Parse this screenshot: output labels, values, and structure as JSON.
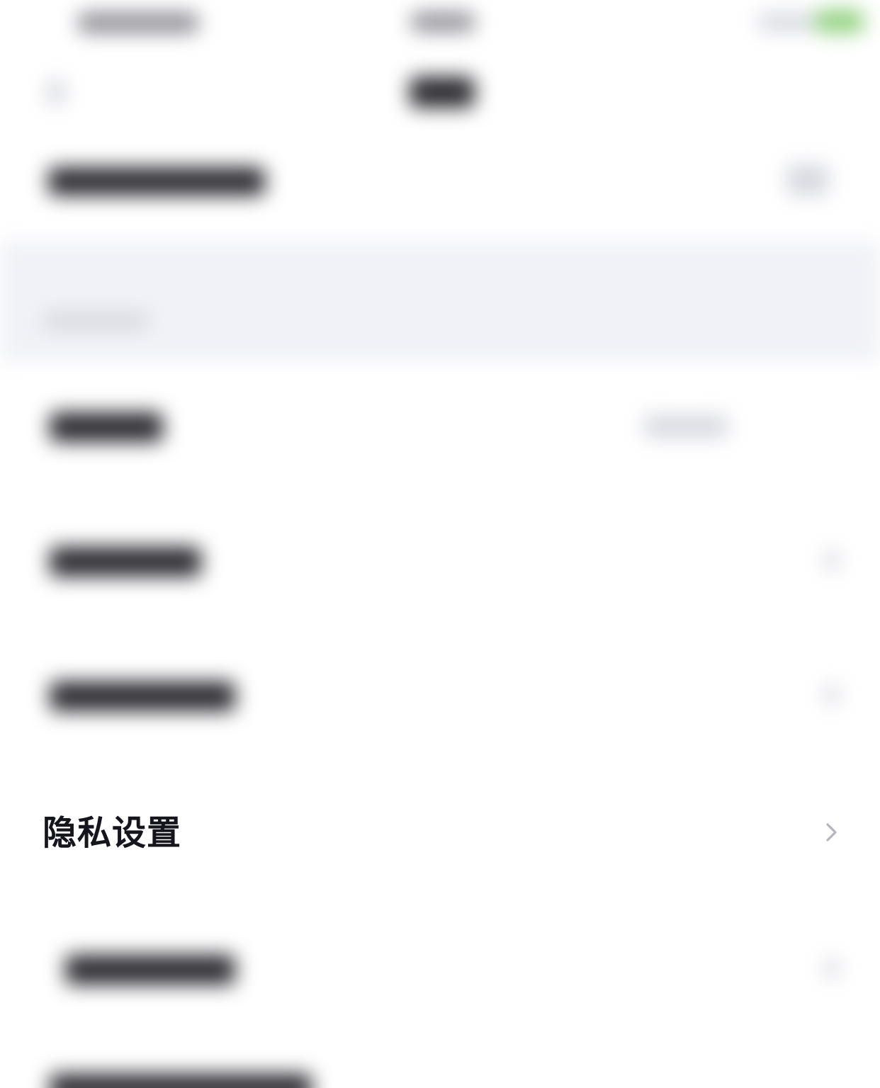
{
  "privacy_settings_row": {
    "label": "隐私设置",
    "chevron_icon": "chevron-right-icon"
  },
  "colors": {
    "text_primary": "#15151d",
    "chevron": "#b3b5bf",
    "section_band": "#f1f2f7",
    "status_green": "#8fd07d"
  }
}
